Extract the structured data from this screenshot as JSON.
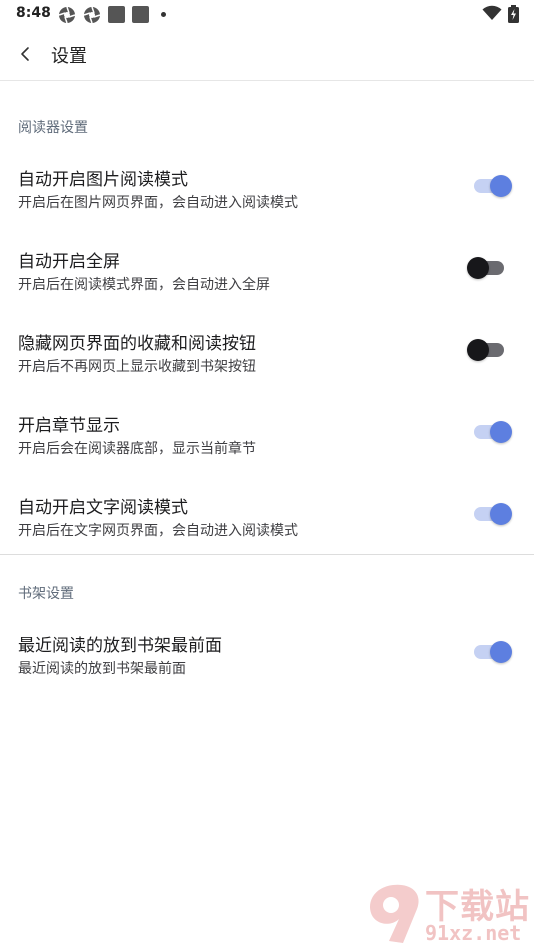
{
  "status_bar": {
    "time": "8:48"
  },
  "app_bar": {
    "title": "设置"
  },
  "sections": [
    {
      "header": "阅读器设置",
      "items": [
        {
          "title": "自动开启图片阅读模式",
          "desc": "开启后在图片网页界面，会自动进入阅读模式",
          "enabled": true
        },
        {
          "title": "自动开启全屏",
          "desc": "开启后在阅读模式界面，会自动进入全屏",
          "enabled": false
        },
        {
          "title": "隐藏网页界面的收藏和阅读按钮",
          "desc": "开启后不再网页上显示收藏到书架按钮",
          "enabled": false
        },
        {
          "title": "开启章节显示",
          "desc": "开启后会在阅读器底部，显示当前章节",
          "enabled": true
        },
        {
          "title": "自动开启文字阅读模式",
          "desc": "开启后在文字网页界面，会自动进入阅读模式",
          "enabled": true
        }
      ]
    },
    {
      "header": "书架设置",
      "items": [
        {
          "title": "最近阅读的放到书架最前面",
          "desc": "最近阅读的放到书架最前面",
          "enabled": true
        }
      ]
    }
  ],
  "watermark": {
    "top_text": "下载站",
    "bottom_text": "91xz.net"
  },
  "colors": {
    "toggle_on_thumb": "#5d7fe0",
    "toggle_on_track": "#c5d1f3",
    "toggle_off_thumb": "#17171a",
    "toggle_off_track": "#6b6b70",
    "section_header": "#5f6b7a"
  }
}
